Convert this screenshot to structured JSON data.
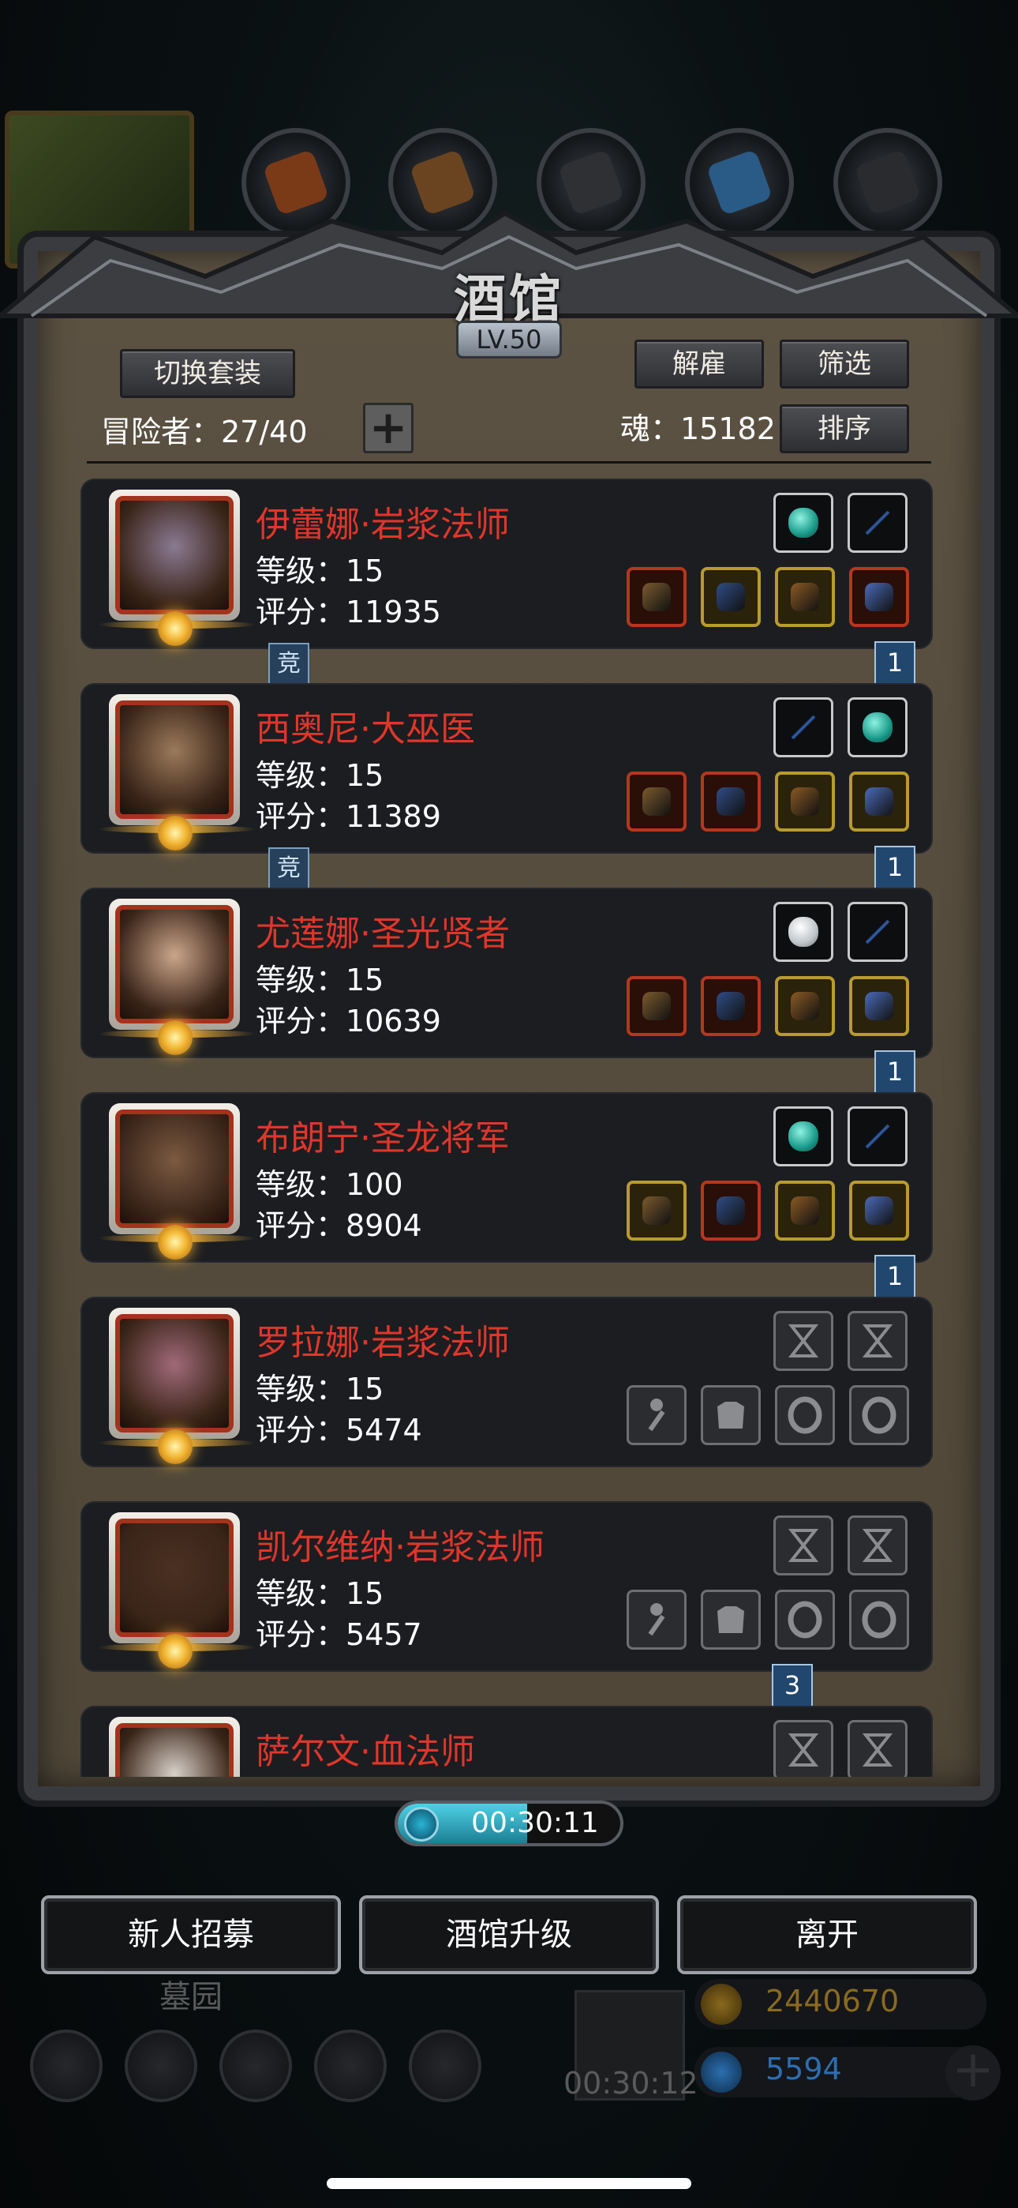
{
  "panel": {
    "title": "酒馆",
    "level": "LV.50",
    "switch_outfit": "切换套装",
    "dismiss": "解雇",
    "filter": "筛选",
    "sort": "排序",
    "adventurer_count": "冒险者：27/40",
    "soul": "魂：15182",
    "plus": "+"
  },
  "heroes": [
    {
      "name": "伊蕾娜·岩浆法师",
      "level": "等级：15",
      "score": "评分：11935",
      "arena_tag": "竞",
      "rank": "1",
      "gems": [
        "teal",
        "ink"
      ],
      "items": [
        "red",
        "gold",
        "gold",
        "red"
      ],
      "portrait": "#8a7a92"
    },
    {
      "name": "西奥尼·大巫医",
      "level": "等级：15",
      "score": "评分：11389",
      "arena_tag": "竞",
      "rank": "1",
      "gems": [
        "ink",
        "teal"
      ],
      "items": [
        "red",
        "red",
        "gold",
        "gold"
      ],
      "portrait": "#9a7a5a"
    },
    {
      "name": "尤莲娜·圣光贤者",
      "level": "等级：15",
      "score": "评分：10639",
      "arena_tag": "",
      "rank": "1",
      "gems": [
        "white",
        "ink"
      ],
      "items": [
        "red",
        "red",
        "gold",
        "gold"
      ],
      "portrait": "#caa58a"
    },
    {
      "name": "布朗宁·圣龙将军",
      "level": "等级：100",
      "score": "评分：8904",
      "arena_tag": "",
      "rank": "1",
      "gems": [
        "teal",
        "ink"
      ],
      "items": [
        "gold",
        "red",
        "gold",
        "gold"
      ],
      "portrait": "#7a5a42"
    },
    {
      "name": "罗拉娜·岩浆法师",
      "level": "等级：15",
      "score": "评分：5474",
      "arena_tag": "",
      "rank": "",
      "gems": [
        "empty",
        "empty"
      ],
      "items": [
        "empty",
        "empty",
        "empty",
        "empty"
      ],
      "portrait": "#a06a78"
    },
    {
      "name": "凯尔维纳·岩浆法师",
      "level": "等级：15",
      "score": "评分：5457",
      "arena_tag": "",
      "rank": "3",
      "gems": [
        "empty",
        "empty"
      ],
      "items": [
        "empty",
        "empty",
        "empty",
        "empty"
      ],
      "portrait": "#4a3022"
    },
    {
      "name": "萨尔文·血法师",
      "level": "",
      "score": "",
      "arena_tag": "",
      "rank": "",
      "gems": [
        "empty",
        "empty"
      ],
      "items": [],
      "portrait": "#d8d0c8"
    }
  ],
  "timer": "00:30:11",
  "buttons": {
    "recruit": "新人招募",
    "upgrade": "酒馆升级",
    "leave": "离开"
  },
  "background": {
    "graveyard": "墓园",
    "gift_timer": "00:30:12",
    "gold": "2440670",
    "diamond": "5594"
  },
  "colors": {
    "name_red": "#e0362a",
    "gold_text": "#8a6a1e",
    "diamond_text": "#2c6fb0"
  }
}
